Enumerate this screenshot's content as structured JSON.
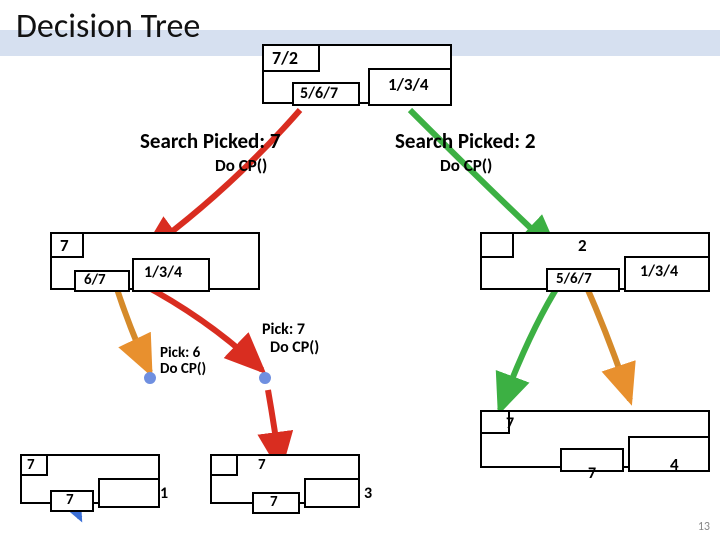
{
  "title": "Decision Tree",
  "root": {
    "label": "7/2"
  },
  "root_children": {
    "left": "5/6/7",
    "right": "1/3/4"
  },
  "search_left": {
    "heading": "Search Picked: 7",
    "action": "Do CP()"
  },
  "search_right": {
    "heading": "Search Picked: 2",
    "action": "Do CP()"
  },
  "node7": {
    "label": "7",
    "child_left": "6/7",
    "child_right": "1/3/4"
  },
  "node2": {
    "label": "2",
    "child_left": "5/6/7",
    "child_right": "1/3/4"
  },
  "pick6": {
    "line1": "Pick: 6",
    "line2": "Do CP()"
  },
  "pick7": {
    "line1": "Pick: 7",
    "line2": "Do CP()"
  },
  "bottom_a_label": "7",
  "bottom_a_child": "7",
  "bottom_a_sibling": "1",
  "bottom_b_label": "7",
  "bottom_b_child": "7",
  "bottom_b_sibling": "3",
  "bottom_c_label": "7",
  "bottom_c_child_left": "7",
  "bottom_c_child_right": "4",
  "page": "13"
}
